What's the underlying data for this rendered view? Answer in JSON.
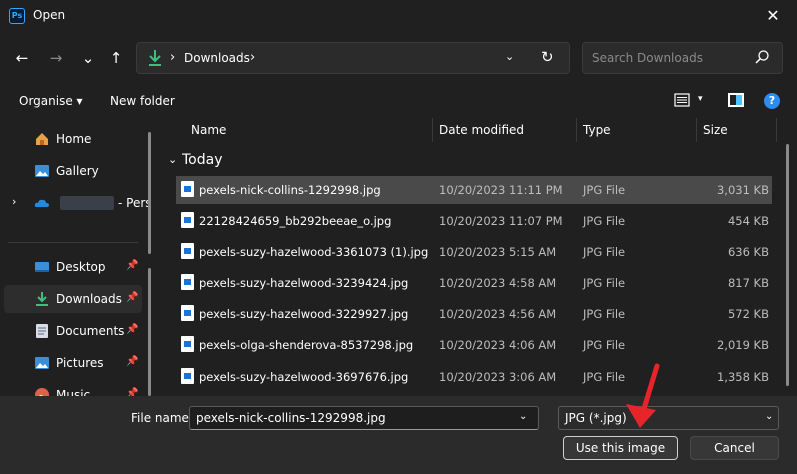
{
  "window": {
    "title": "Open",
    "app_icon_text": "Ps",
    "close_glyph": "✕"
  },
  "nav": {
    "back": "←",
    "forward": "→",
    "recent": "⌄",
    "up": "↑",
    "path": [
      {
        "label": "Downloads"
      }
    ],
    "sep": "›",
    "chevron": "⌄",
    "refresh": "↻",
    "search_placeholder": "Search Downloads"
  },
  "commands": {
    "organise": "Organise ▾",
    "new_folder": "New folder",
    "view_chevron": "▾",
    "help": "?"
  },
  "sidebar": {
    "items": [
      {
        "label": "Home",
        "icon": "home-icon"
      },
      {
        "label": "Gallery",
        "icon": "gallery-icon"
      },
      {
        "label": "- Pers",
        "icon": "onedrive-icon",
        "expander": "›"
      },
      {
        "label": "Desktop",
        "icon": "desktop-icon",
        "pin": "📌"
      },
      {
        "label": "Downloads",
        "icon": "download-icon",
        "pin": "📌"
      },
      {
        "label": "Documents",
        "icon": "documents-icon",
        "pin": "📌"
      },
      {
        "label": "Pictures",
        "icon": "pictures-icon",
        "pin": "📌"
      },
      {
        "label": "Music",
        "icon": "music-icon",
        "pin": "📌"
      }
    ]
  },
  "columns": {
    "name": "Name",
    "date": "Date modified",
    "type": "Type",
    "size": "Size",
    "sort_caret": "⌃"
  },
  "group": {
    "label": "Today",
    "chevron": "⌄"
  },
  "files": [
    {
      "name": "pexels-nick-collins-1292998.jpg",
      "date": "10/20/2023 11:11 PM",
      "type": "JPG File",
      "size": "3,031 KB",
      "selected": true
    },
    {
      "name": "22128424659_bb292beeae_o.jpg",
      "date": "10/20/2023 11:07 PM",
      "type": "JPG File",
      "size": "454 KB"
    },
    {
      "name": "pexels-suzy-hazelwood-3361073 (1).jpg",
      "date": "10/20/2023 5:15 AM",
      "type": "JPG File",
      "size": "636 KB"
    },
    {
      "name": "pexels-suzy-hazelwood-3239424.jpg",
      "date": "10/20/2023 4:58 AM",
      "type": "JPG File",
      "size": "817 KB"
    },
    {
      "name": "pexels-suzy-hazelwood-3229927.jpg",
      "date": "10/20/2023 4:56 AM",
      "type": "JPG File",
      "size": "572 KB"
    },
    {
      "name": "pexels-olga-shenderova-8537298.jpg",
      "date": "10/20/2023 4:06 AM",
      "type": "JPG File",
      "size": "2,019 KB"
    },
    {
      "name": "pexels-suzy-hazelwood-3697676.jpg",
      "date": "10/20/2023 3:06 AM",
      "type": "JPG File",
      "size": "1,358 KB"
    }
  ],
  "footer": {
    "file_name_label": "File name:",
    "file_name_value": "pexels-nick-collins-1292998.jpg",
    "file_type_value": "JPG (*.jpg)",
    "chevron": "⌄",
    "open_button": "Use this image",
    "cancel_button": "Cancel"
  },
  "colors": {
    "background": "#202020",
    "footer": "#2b2b2b",
    "selected_row": "#4a4a4a",
    "accent": "#4cc2ff",
    "annotation_arrow": "#e8242b"
  }
}
